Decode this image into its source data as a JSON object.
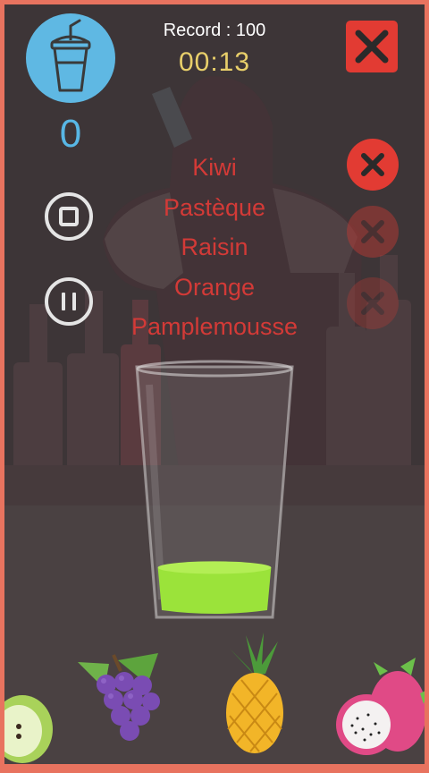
{
  "header": {
    "record_text": "Record : 100",
    "timer_text": "00:13"
  },
  "score": {
    "value": "0",
    "badge_icon": "smoothie-cup-icon"
  },
  "controls": {
    "stop_icon": "stop-icon",
    "pause_icon": "pause-icon",
    "close_icon": "close-icon"
  },
  "recipe": {
    "ingredients": [
      "Kiwi",
      "Pastèque",
      "Raisin",
      "Orange",
      "Pamplemousse"
    ]
  },
  "misses": {
    "total": 3,
    "used": 1
  },
  "glass": {
    "fill_color": "#9be33a",
    "fill_level": 0.2
  },
  "fruits": [
    "apple",
    "grapes",
    "pineapple",
    "dragon-fruit"
  ],
  "colors": {
    "frame": "#e8735f",
    "accent_blue": "#5fb8e3",
    "danger_red": "#e23b33",
    "timer_yellow": "#e8cf6a",
    "recipe_red": "#d33a37"
  }
}
